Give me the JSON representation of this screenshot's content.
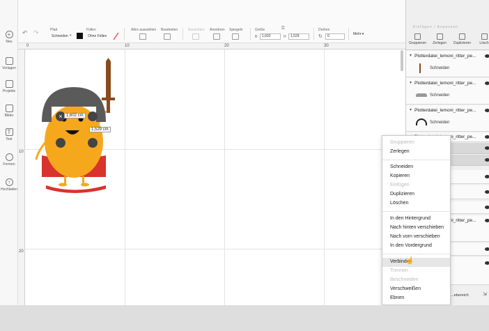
{
  "sidebar": {
    "items": [
      {
        "label": "Neu",
        "icon": "plus-icon"
      },
      {
        "label": "Vorlagen",
        "icon": "shirt-icon"
      },
      {
        "label": "Projekte",
        "icon": "projects-icon"
      },
      {
        "label": "Bilder",
        "icon": "image-icon"
      },
      {
        "label": "Text",
        "icon": "text-icon"
      },
      {
        "label": "Formen",
        "icon": "shapes-icon"
      },
      {
        "label": "Hochladen",
        "icon": "cloud-upload-icon"
      }
    ]
  },
  "toolbar": {
    "linetype_label": "Pfad",
    "linetype_value": "Schneiden",
    "fill_label": "Füllen",
    "fill_value": "Ohne Füllen",
    "select_all_label": "Alles auswählen",
    "edit_label": "Bearbeiten",
    "align_label": "Ausrichten",
    "arrange_label": "Anordnen",
    "mirror_label": "Spiegeln",
    "size_label": "Größe",
    "width_prefix": "B",
    "width_value": "1,602",
    "height_prefix": "H",
    "height_value": "1,529",
    "rotate_label": "Drehen",
    "rotate_value": "0",
    "more_label": "Mehr ▾",
    "fill_color": "#111111",
    "pen_color": "#d42020"
  },
  "ruler": {
    "top_marks": [
      "0",
      "10",
      "20",
      "30"
    ],
    "left_marks": [
      "10",
      "20"
    ]
  },
  "figure": {
    "width_label": "1,602 cm",
    "height_label": "1,529 cm",
    "body_color": "#f6a81d",
    "cape_color": "#d8332c",
    "helmet_color": "#5a5a5a",
    "sword_color": "#8a4a1c"
  },
  "panel": {
    "header_faint": "Einfügen / Anpassen",
    "buttons": [
      {
        "label": "Gruppieren",
        "icon": "group-icon"
      },
      {
        "label": "Zerlegen",
        "icon": "ungroup-icon"
      },
      {
        "label": "Duplizieren",
        "icon": "duplicate-icon"
      },
      {
        "label": "Lösch",
        "icon": "trash-icon"
      }
    ],
    "layers": [
      {
        "title": "Plotterdatei_lemoni_ritter_pe...",
        "sub": "Schneiden"
      },
      {
        "title": "Plotterdatei_lemoni_ritter_pe...",
        "sub": "Schneiden"
      },
      {
        "title": "Plotterdatei_lemoni_ritter_pe...",
        "sub": "Schneiden"
      },
      {
        "title": "Plotterdatei_lemoni_ritter_pe...",
        "sub": ""
      },
      {
        "title": "Plotterdatei_lemoni_ritter_pe...",
        "sub": ""
      }
    ],
    "canvas_hint": "...ebereich"
  },
  "context_menu": {
    "groups": [
      [
        {
          "label": "Gruppieren",
          "disabled": true
        },
        {
          "label": "Zerlegen",
          "disabled": false
        }
      ],
      [
        {
          "label": "Schneiden",
          "disabled": false
        },
        {
          "label": "Kopieren",
          "disabled": false
        },
        {
          "label": "Einfügen",
          "disabled": true
        },
        {
          "label": "Duplizieren",
          "disabled": false
        },
        {
          "label": "Löschen",
          "disabled": false
        }
      ],
      [
        {
          "label": "In den Hintergrund",
          "disabled": false
        },
        {
          "label": "Nach hinten verschieben",
          "disabled": false
        },
        {
          "label": "Nach vorn verschieben",
          "disabled": false
        },
        {
          "label": "In den Vordergrund",
          "disabled": false
        }
      ],
      [
        {
          "label": "Verbinden",
          "disabled": false,
          "hovered": true
        },
        {
          "label": "Trennen",
          "disabled": true
        },
        {
          "label": "Beschneiden",
          "disabled": true
        },
        {
          "label": "Verschweißen",
          "disabled": false
        },
        {
          "label": "Ebnen",
          "disabled": false
        }
      ]
    ]
  }
}
